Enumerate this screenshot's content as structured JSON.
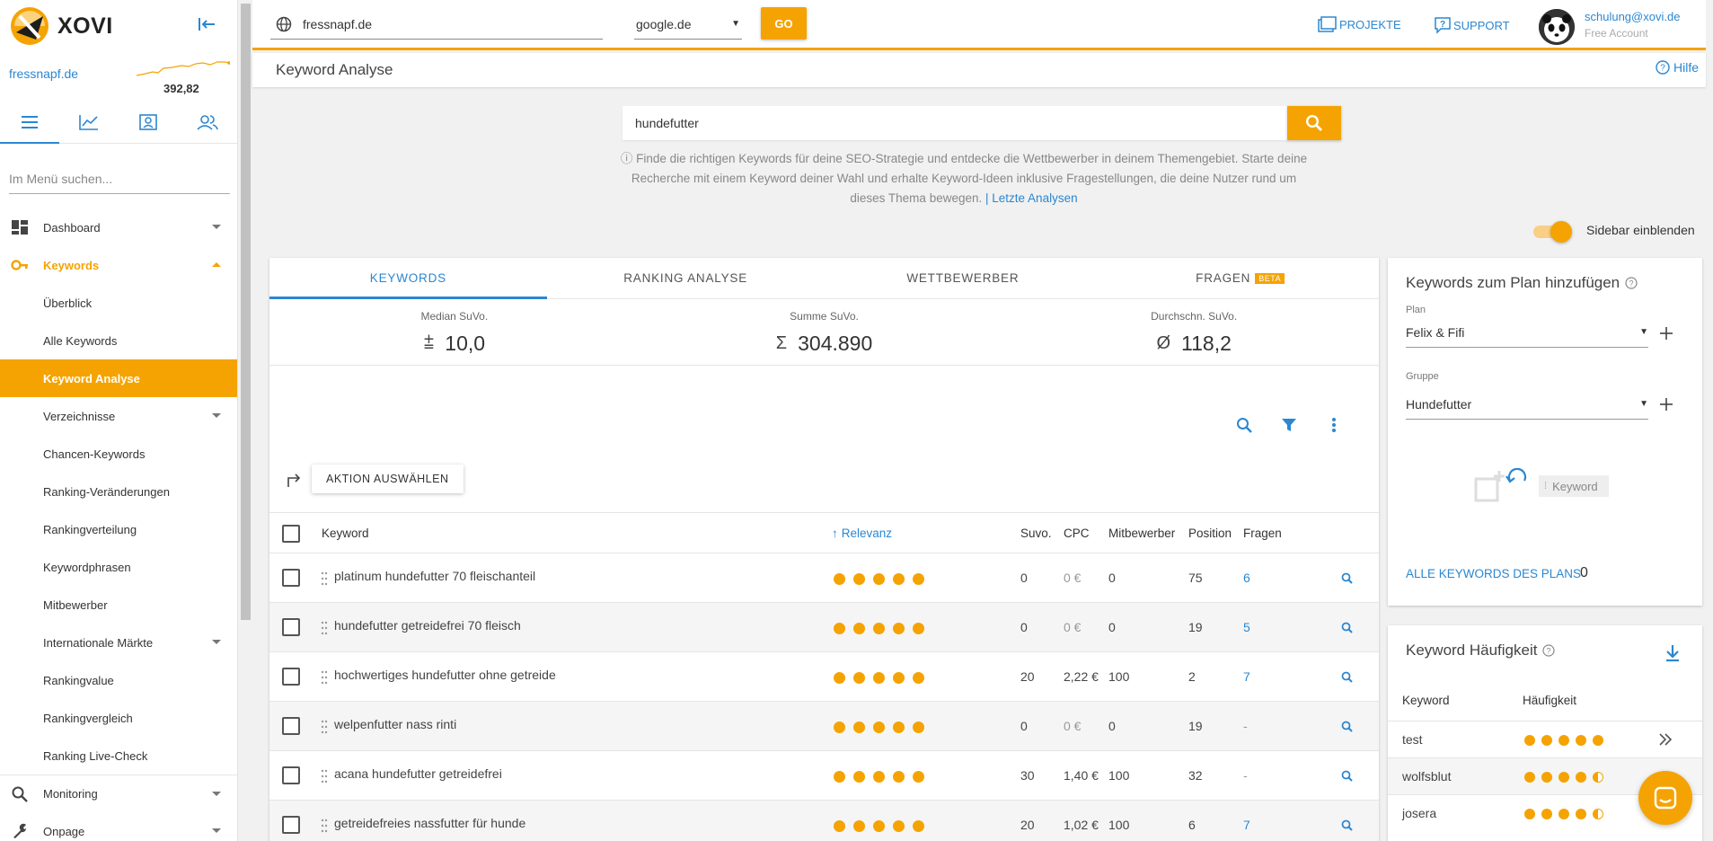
{
  "app": {
    "name": "XOVI"
  },
  "sidebar": {
    "project": "fressnapf.de",
    "value": "392,82",
    "search_placeholder": "Im Menü suchen...",
    "items": [
      {
        "label": "Dashboard"
      },
      {
        "label": "Keywords"
      },
      {
        "label": "Überblick"
      },
      {
        "label": "Alle Keywords"
      },
      {
        "label": "Keyword Analyse"
      },
      {
        "label": "Verzeichnisse"
      },
      {
        "label": "Chancen-Keywords"
      },
      {
        "label": "Ranking-Veränderungen"
      },
      {
        "label": "Rankingverteilung"
      },
      {
        "label": "Keywordphrasen"
      },
      {
        "label": "Mitbewerber"
      },
      {
        "label": "Internationale Märkte"
      },
      {
        "label": "Rankingvalue"
      },
      {
        "label": "Rankingvergleich"
      },
      {
        "label": "Ranking Live-Check"
      },
      {
        "label": "Monitoring"
      },
      {
        "label": "Onpage"
      }
    ]
  },
  "topbar": {
    "domain": "fressnapf.de",
    "engine": "google.de",
    "go_label": "GO",
    "projects_label": "PROJEKTE",
    "support_label": "SUPPORT",
    "user_email": "schulung@xovi.de",
    "user_plan": "Free Account"
  },
  "page": {
    "title": "Keyword Analyse",
    "help_label": "Hilfe",
    "search_value": "hundefutter",
    "intro_text": "Finde die richtigen Keywords für deine SEO-Strategie und entdecke die Wettbewerber in deinem Themengebiet. Starte deine Recherche mit einem Keyword deiner Wahl und erhalte Keyword-Ideen inklusive Fragestellungen, die deine Nutzer rund um dieses Thema bewegen.",
    "last_analyses_link": "| Letzte Analysen",
    "sidebar_toggle_label": "Sidebar einblenden"
  },
  "main": {
    "tabs": [
      {
        "label": "KEYWORDS"
      },
      {
        "label": "RANKING ANALYSE"
      },
      {
        "label": "WETTBEWERBER"
      },
      {
        "label": "FRAGEN",
        "badge": "BETA"
      }
    ],
    "stats": [
      {
        "label": "Median SuVo.",
        "symbol": "⩲",
        "value": "10,0"
      },
      {
        "label": "Summe SuVo.",
        "symbol": "Σ",
        "value": "304.890"
      },
      {
        "label": "Durchschn. SuVo.",
        "symbol": "Ø",
        "value": "118,2"
      }
    ],
    "action_label": "AKTION AUSWÄHLEN",
    "columns": {
      "keyword": "Keyword",
      "relevance": "Relevanz",
      "suvo": "Suvo.",
      "cpc": "CPC",
      "competitors": "Mitbewerber",
      "position": "Position",
      "questions": "Fragen"
    },
    "rows": [
      {
        "keyword": "platinum hundefutter 70 fleischanteil",
        "relevance": 5,
        "suvo": "0",
        "cpc": "0 €",
        "competitors": "0",
        "position": "75",
        "questions": "6"
      },
      {
        "keyword": "hundefutter getreidefrei 70 fleisch",
        "relevance": 5,
        "suvo": "0",
        "cpc": "0 €",
        "competitors": "0",
        "position": "19",
        "questions": "5"
      },
      {
        "keyword": "hochwertiges hundefutter ohne getreide",
        "relevance": 5,
        "suvo": "20",
        "cpc": "2,22 €",
        "competitors": "100",
        "position": "2",
        "questions": "7"
      },
      {
        "keyword": "welpenfutter nass rinti",
        "relevance": 5,
        "suvo": "0",
        "cpc": "0 €",
        "competitors": "0",
        "position": "19",
        "questions": "-"
      },
      {
        "keyword": "acana hundefutter getreidefrei",
        "relevance": 5,
        "suvo": "30",
        "cpc": "1,40 €",
        "competitors": "100",
        "position": "32",
        "questions": "-"
      },
      {
        "keyword": "getreidefreies nassfutter für hunde",
        "relevance": 5,
        "suvo": "20",
        "cpc": "1,02 €",
        "competitors": "100",
        "position": "6",
        "questions": "7"
      }
    ]
  },
  "plan_card": {
    "title": "Keywords zum Plan hinzufügen",
    "plan_label": "Plan",
    "plan_value": "Felix & Fifi",
    "group_label": "Gruppe",
    "group_value": "Hundefutter",
    "chip_label": "Keyword",
    "all_keywords_label": "ALLE KEYWORDS DES PLANS",
    "all_keywords_count": "0"
  },
  "freq_card": {
    "title": "Keyword Häufigkeit",
    "col_keyword": "Keyword",
    "col_freq": "Häufigkeit",
    "rows": [
      {
        "keyword": "test",
        "level": 5
      },
      {
        "keyword": "wolfsblut",
        "level": 4.5
      },
      {
        "keyword": "josera",
        "level": 4.5
      }
    ]
  },
  "colors": {
    "accent": "#f5a302",
    "link": "#2b87d1"
  }
}
